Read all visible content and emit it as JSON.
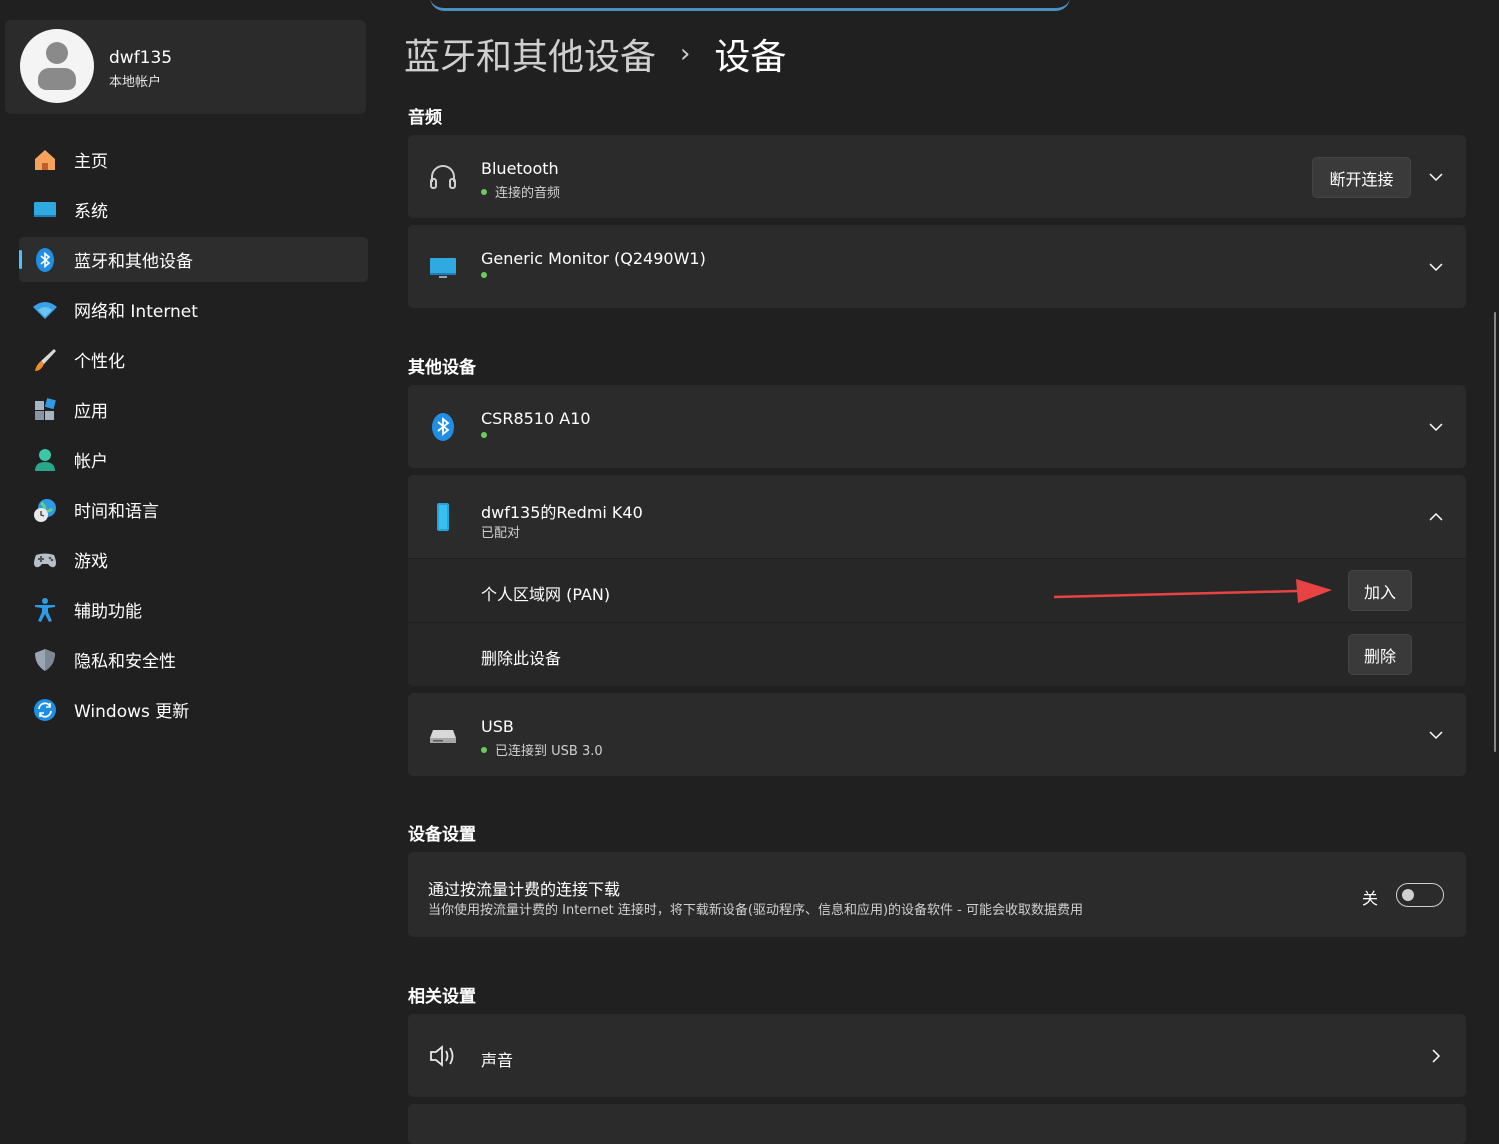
{
  "profile": {
    "name": "dwf135",
    "account_type": "本地帐户"
  },
  "sidebar": {
    "items": [
      {
        "label": "主页",
        "icon": "home-icon",
        "active": false
      },
      {
        "label": "系统",
        "icon": "system-icon",
        "active": false
      },
      {
        "label": "蓝牙和其他设备",
        "icon": "bluetooth-icon",
        "active": true
      },
      {
        "label": "网络和 Internet",
        "icon": "wifi-icon",
        "active": false
      },
      {
        "label": "个性化",
        "icon": "brush-icon",
        "active": false
      },
      {
        "label": "应用",
        "icon": "apps-icon",
        "active": false
      },
      {
        "label": "帐户",
        "icon": "account-icon",
        "active": false
      },
      {
        "label": "时间和语言",
        "icon": "globe-clock-icon",
        "active": false
      },
      {
        "label": "游戏",
        "icon": "gamepad-icon",
        "active": false
      },
      {
        "label": "辅助功能",
        "icon": "accessibility-icon",
        "active": false
      },
      {
        "label": "隐私和安全性",
        "icon": "shield-icon",
        "active": false
      },
      {
        "label": "Windows 更新",
        "icon": "update-icon",
        "active": false
      }
    ]
  },
  "breadcrumb": {
    "parent": "蓝牙和其他设备",
    "separator": "›",
    "current": "设备"
  },
  "audio": {
    "title": "音频",
    "devices": [
      {
        "name": "Bluetooth",
        "status": "连接的音频",
        "button": "断开连接",
        "icon": "headphones-icon"
      },
      {
        "name": "Generic Monitor (Q2490W1)",
        "status": "",
        "icon": "monitor-icon"
      }
    ]
  },
  "other": {
    "title": "其他设备",
    "devices": [
      {
        "name": "CSR8510 A10",
        "status": "",
        "icon": "bluetooth-icon"
      },
      {
        "name": "dwf135的Redmi K40",
        "status": "已配对",
        "icon": "phone-icon",
        "expanded": {
          "pan_label": "个人区域网 (PAN)",
          "pan_button": "加入",
          "remove_label": "删除此设备",
          "remove_button": "删除"
        }
      },
      {
        "name": "USB",
        "status": "已连接到 USB 3.0",
        "icon": "drive-icon"
      }
    ]
  },
  "device_settings": {
    "title": "设备设置",
    "metered": {
      "title": "通过按流量计费的连接下载",
      "description": "当你使用按流量计费的 Internet 连接时，将下载新设备(驱动程序、信息和应用)的设备软件 - 可能会收取数据费用",
      "state_label": "关",
      "on": false
    }
  },
  "related": {
    "title": "相关设置",
    "items": [
      {
        "label": "声音",
        "icon": "speaker-icon"
      }
    ]
  },
  "colors": {
    "accent": "#4cc2ff",
    "status_green": "#6ccb5f",
    "arrow": "#e84343"
  }
}
